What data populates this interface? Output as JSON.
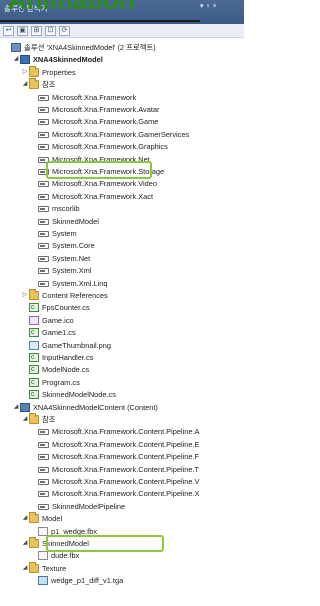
{
  "overlay_title": "Animation",
  "panel": {
    "title": "솔루션 탐색기",
    "pin": "▾ ♀ ×"
  },
  "toolbar": {
    "buttons": [
      "↩",
      "▣",
      "⊞",
      "⊡",
      "⟳"
    ]
  },
  "tree": {
    "rows": [
      {
        "text": "솔루션 'XNA4SkinnedModel' (2 프로젝트)",
        "icon": "solution",
        "icon_name": "solution-icon",
        "indent": 0,
        "exp": ""
      },
      {
        "text": "XNA4SkinnedModel",
        "icon": "csproj",
        "icon_name": "csharp-project-icon",
        "indent": 1,
        "exp": "◢",
        "bold": true
      },
      {
        "text": "Properties",
        "icon": "folder",
        "icon_name": "properties-folder-icon",
        "indent": 2,
        "exp": "▷"
      },
      {
        "text": "참조",
        "icon": "folder",
        "icon_name": "references-folder-icon",
        "indent": 2,
        "exp": "◢"
      },
      {
        "text": "Microsoft.Xna.Framework",
        "icon": "ref",
        "icon_name": "reference-icon",
        "indent": 3,
        "exp": ""
      },
      {
        "text": "Microsoft.Xna.Framework.Avatar",
        "icon": "ref",
        "icon_name": "reference-icon",
        "indent": 3,
        "exp": ""
      },
      {
        "text": "Microsoft.Xna.Framework.Game",
        "icon": "ref",
        "icon_name": "reference-icon",
        "indent": 3,
        "exp": ""
      },
      {
        "text": "Microsoft.Xna.Framework.GamerServices",
        "icon": "ref",
        "icon_name": "reference-icon",
        "indent": 3,
        "exp": ""
      },
      {
        "text": "Microsoft.Xna.Framework.Graphics",
        "icon": "ref",
        "icon_name": "reference-icon",
        "indent": 3,
        "exp": ""
      },
      {
        "text": "Microsoft.Xna.Framework.Net",
        "icon": "ref",
        "icon_name": "reference-icon",
        "indent": 3,
        "exp": ""
      },
      {
        "text": "Microsoft.Xna.Framework.Storage",
        "icon": "ref",
        "icon_name": "reference-icon",
        "indent": 3,
        "exp": ""
      },
      {
        "text": "Microsoft.Xna.Framework.Video",
        "icon": "ref",
        "icon_name": "reference-icon",
        "indent": 3,
        "exp": ""
      },
      {
        "text": "Microsoft.Xna.Framework.Xact",
        "icon": "ref",
        "icon_name": "reference-icon",
        "indent": 3,
        "exp": ""
      },
      {
        "text": "mscorlib",
        "icon": "ref",
        "icon_name": "reference-icon",
        "indent": 3,
        "exp": ""
      },
      {
        "text": "SkinnedModel",
        "icon": "ref",
        "icon_name": "reference-icon",
        "indent": 3,
        "exp": ""
      },
      {
        "text": "System",
        "icon": "ref",
        "icon_name": "reference-icon",
        "indent": 3,
        "exp": ""
      },
      {
        "text": "System.Core",
        "icon": "ref",
        "icon_name": "reference-icon",
        "indent": 3,
        "exp": ""
      },
      {
        "text": "System.Net",
        "icon": "ref",
        "icon_name": "reference-icon",
        "indent": 3,
        "exp": ""
      },
      {
        "text": "System.Xml",
        "icon": "ref",
        "icon_name": "reference-icon",
        "indent": 3,
        "exp": ""
      },
      {
        "text": "System.Xml.Linq",
        "icon": "ref",
        "icon_name": "reference-icon",
        "indent": 3,
        "exp": ""
      },
      {
        "text": "Content References",
        "icon": "folder",
        "icon_name": "content-references-folder-icon",
        "indent": 2,
        "exp": "▷"
      },
      {
        "text": "FpsCounter.cs",
        "icon": "cs",
        "icon_name": "csharp-file-icon",
        "indent": 2,
        "exp": ""
      },
      {
        "text": "Game.ico",
        "icon": "ico-file",
        "icon_name": "icon-file-icon",
        "indent": 2,
        "exp": ""
      },
      {
        "text": "Game1.cs",
        "icon": "cs",
        "icon_name": "csharp-file-icon",
        "indent": 2,
        "exp": ""
      },
      {
        "text": "GameThumbnail.png",
        "icon": "png",
        "icon_name": "image-file-icon",
        "indent": 2,
        "exp": ""
      },
      {
        "text": "InputHandler.cs",
        "icon": "cs",
        "icon_name": "csharp-file-icon",
        "indent": 2,
        "exp": ""
      },
      {
        "text": "ModelNode.cs",
        "icon": "cs",
        "icon_name": "csharp-file-icon",
        "indent": 2,
        "exp": ""
      },
      {
        "text": "Program.cs",
        "icon": "cs",
        "icon_name": "csharp-file-icon",
        "indent": 2,
        "exp": ""
      },
      {
        "text": "SkinnedModelNode.cs",
        "icon": "cs",
        "icon_name": "csharp-file-icon",
        "indent": 2,
        "exp": ""
      },
      {
        "text": "XNA4SkinnedModelContent (Content)",
        "icon": "content",
        "icon_name": "content-project-icon",
        "indent": 1,
        "exp": "◢"
      },
      {
        "text": "참조",
        "icon": "folder",
        "icon_name": "references-folder-icon",
        "indent": 2,
        "exp": "◢"
      },
      {
        "text": "Microsoft.Xna.Framework.Content.Pipeline.A",
        "icon": "ref",
        "icon_name": "reference-icon",
        "indent": 3,
        "exp": ""
      },
      {
        "text": "Microsoft.Xna.Framework.Content.Pipeline.E",
        "icon": "ref",
        "icon_name": "reference-icon",
        "indent": 3,
        "exp": ""
      },
      {
        "text": "Microsoft.Xna.Framework.Content.Pipeline.F",
        "icon": "ref",
        "icon_name": "reference-icon",
        "indent": 3,
        "exp": ""
      },
      {
        "text": "Microsoft.Xna.Framework.Content.Pipeline.T",
        "icon": "ref",
        "icon_name": "reference-icon",
        "indent": 3,
        "exp": ""
      },
      {
        "text": "Microsoft.Xna.Framework.Content.Pipeline.V",
        "icon": "ref",
        "icon_name": "reference-icon",
        "indent": 3,
        "exp": ""
      },
      {
        "text": "Microsoft.Xna.Framework.Content.Pipeline.X",
        "icon": "ref",
        "icon_name": "reference-icon",
        "indent": 3,
        "exp": ""
      },
      {
        "text": "SkinnedModelPipeline",
        "icon": "ref",
        "icon_name": "reference-icon",
        "indent": 3,
        "exp": ""
      },
      {
        "text": "Model",
        "icon": "folder",
        "icon_name": "folder-icon",
        "indent": 2,
        "exp": "◢"
      },
      {
        "text": "p1_wedge.fbx",
        "icon": "fbx",
        "icon_name": "fbx-file-icon",
        "indent": 3,
        "exp": ""
      },
      {
        "text": "SkinnedModel",
        "icon": "folder",
        "icon_name": "folder-icon",
        "indent": 2,
        "exp": "◢"
      },
      {
        "text": "dude.fbx",
        "icon": "fbx",
        "icon_name": "fbx-file-icon",
        "indent": 3,
        "exp": ""
      },
      {
        "text": "Texture",
        "icon": "folder",
        "icon_name": "folder-icon",
        "indent": 2,
        "exp": "◢"
      },
      {
        "text": "wedge_p1_diff_v1.tga",
        "icon": "tga",
        "icon_name": "texture-file-icon",
        "indent": 3,
        "exp": ""
      }
    ]
  },
  "colors": {
    "highlight": "#8fc63c",
    "overlay_title": "#2a8d1a",
    "header": "#3c5a86"
  }
}
